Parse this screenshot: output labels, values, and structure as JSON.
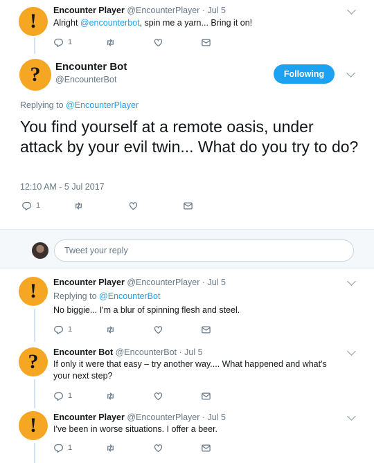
{
  "tweets_top": [
    {
      "name": "Encounter Player",
      "handle": "@EncounterPlayer",
      "time": "· Jul 5",
      "text_prefix": "Alright ",
      "mention": "@encounterbot",
      "text_suffix": ", spin me a yarn... Bring it on!",
      "replies": "1"
    }
  ],
  "main": {
    "name": "Encounter Bot",
    "handle": "@EncounterBot",
    "follow_label": "Following",
    "replying_label": "Replying to ",
    "replying_handle": "@EncounterPlayer",
    "text": "You find yourself at a remote oasis, under attack by your evil twin... What do you try to do?",
    "timestamp": "12:10 AM - 5 Jul 2017",
    "replies": "1"
  },
  "reply_box": {
    "placeholder": "Tweet your reply"
  },
  "replies": [
    {
      "name": "Encounter Player",
      "handle": "@EncounterPlayer",
      "time": "· Jul 5",
      "replying_label": "Replying to ",
      "replying_handle": "@EncounterBot",
      "text": "No biggie... I'm a blur of spinning flesh and steel.",
      "replies": "1"
    },
    {
      "name": "Encounter Bot",
      "handle": "@EncounterBot",
      "time": "· Jul 5",
      "text": "If only it were that easy – try another way.... What happened and what's your next step?",
      "replies": "1"
    },
    {
      "name": "Encounter Player",
      "handle": "@EncounterPlayer",
      "time": "· Jul 5",
      "text": "I've been in worse situations. I offer a beer.",
      "replies": "1"
    }
  ],
  "colors": {
    "accent": "#1da1f2",
    "avatar_bg": "#f5a623"
  },
  "icons": {
    "player_avatar": "exclamation-icon",
    "bot_avatar": "question-icon"
  }
}
